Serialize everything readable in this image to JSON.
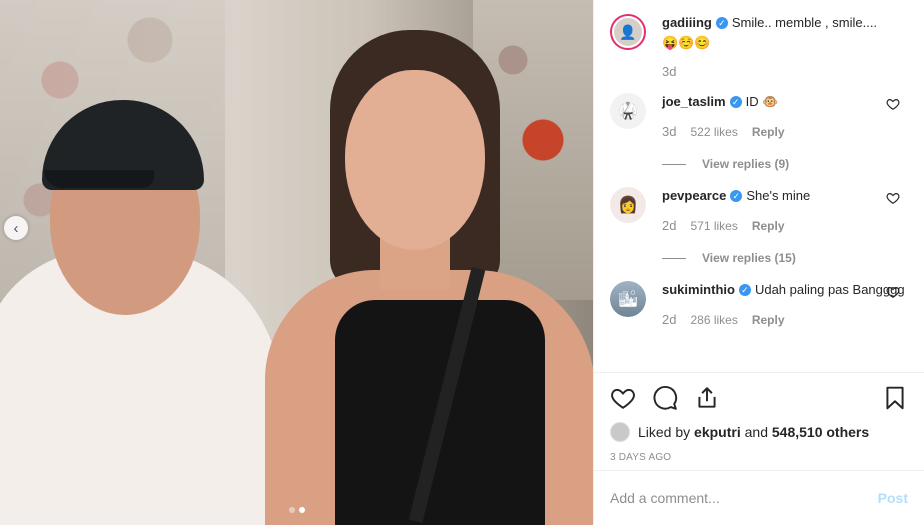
{
  "post": {
    "carousel": {
      "slide_count": 2,
      "active_slide": 2
    },
    "caption": {
      "username": "gadiiing",
      "text": "Smile.. memble , smile....",
      "emoji": "😝☺️😊",
      "time": "3d"
    },
    "comments": [
      {
        "username": "joe_taslim",
        "text": "ID 🐵",
        "time": "3d",
        "likes": "522 likes",
        "reply": "Reply",
        "view_replies": "View replies (9)"
      },
      {
        "username": "pevpearce",
        "text": "She's mine",
        "time": "2d",
        "likes": "571 likes",
        "reply": "Reply",
        "view_replies": "View replies (15)"
      },
      {
        "username": "sukiminthio",
        "text": "Udah paling pas Bangggg",
        "time": "2d",
        "likes": "286 likes",
        "reply": "Reply"
      }
    ],
    "liked_by": {
      "prefix": "Liked by",
      "user": "ekputri",
      "and": "and",
      "others": "548,510 others"
    },
    "date": "3 DAYS AGO",
    "add_comment": {
      "placeholder": "Add a comment...",
      "post_label": "Post"
    }
  },
  "colors": {
    "verified": "#3897f0",
    "muted": "#8e8e8e",
    "post_disabled": "#b2dffc",
    "story_ring": "#e1306c"
  },
  "icons": [
    "chevron-left-icon",
    "heart-icon",
    "comment-icon",
    "share-icon",
    "bookmark-icon",
    "verified-icon"
  ]
}
